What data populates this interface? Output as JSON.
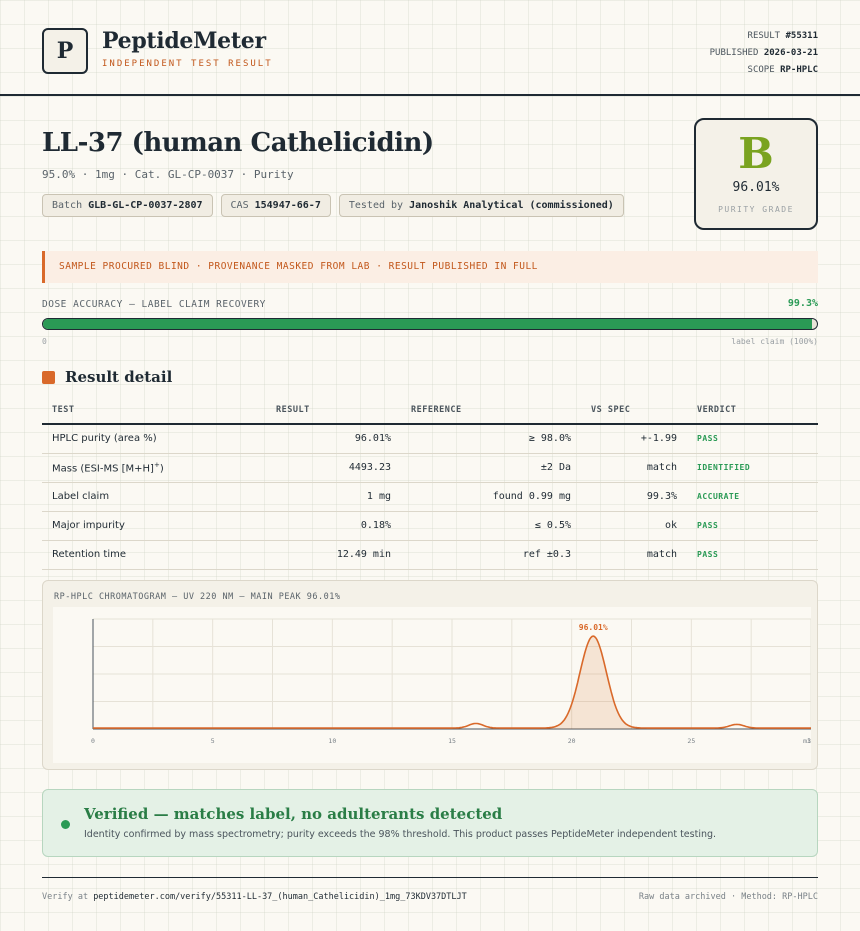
{
  "brand": {
    "logo_letter": "P",
    "name": "PeptideMeter",
    "subtitle": "INDEPENDENT TEST RESULT"
  },
  "meta": {
    "result_label": "RESULT",
    "result_value": "#55311",
    "published_label": "PUBLISHED",
    "published_value": "2026-03-21",
    "scope_label": "SCOPE",
    "scope_value": "RP-HPLC"
  },
  "product": {
    "title": "LL-37 (human Cathelicidin)",
    "subline": "95.0% · 1mg · Cat. GL-CP-0037 · Purity",
    "batch_label": "Batch",
    "batch_value": "GLB-GL-CP-0037-2807",
    "cas_label": "CAS",
    "cas_value": "154947-66-7",
    "tested_label": "Tested by",
    "tested_value": "Janoshik Analytical (commissioned)"
  },
  "grade": {
    "letter": "B",
    "value": "96.01%",
    "label": "PURITY GRADE",
    "color": "#7aa320"
  },
  "notice": "SAMPLE PROCURED BLIND · PROVENANCE MASKED FROM LAB · RESULT PUBLISHED IN FULL",
  "dose": {
    "label": "DOSE ACCURACY — LABEL CLAIM RECOVERY",
    "value_text": "99.3%",
    "fraction": 0.993,
    "min_label": "0",
    "max_label": "label claim (100%)"
  },
  "section_title": "Result detail",
  "table": {
    "headers": [
      "TEST",
      "RESULT",
      "REFERENCE",
      "VS SPEC",
      "VERDICT"
    ],
    "rows": [
      {
        "test": "HPLC purity (area %)",
        "result": "96.01%",
        "reference": "≥ 98.0%",
        "vs_spec": "+-1.99",
        "verdict": "PASS"
      },
      {
        "test": "Mass (ESI-MS [M+H]",
        "test_sup": "+",
        "test_end": ")",
        "result": "4493.23",
        "reference": "±2 Da",
        "vs_spec": "match",
        "verdict": "IDENTIFIED"
      },
      {
        "test": "Label claim",
        "result": "1 mg",
        "reference": "found 0.99 mg",
        "vs_spec": "99.3%",
        "verdict": "ACCURATE"
      },
      {
        "test": "Major impurity",
        "result": "0.18%",
        "reference": "≤ 0.5%",
        "vs_spec": "ok",
        "verdict": "PASS"
      },
      {
        "test": "Retention time",
        "result": "12.49 min",
        "reference": "ref ±0.3",
        "vs_spec": "match",
        "verdict": "PASS"
      }
    ]
  },
  "chart_data": {
    "type": "line",
    "title": "RP-HPLC CHROMATOGRAM — UV 220 NM — MAIN PEAK 96.01%",
    "xlabel": "min",
    "ylabel": "",
    "xlim": [
      0,
      30
    ],
    "x_ticks": [
      "0",
      "5",
      "10",
      "15",
      "20",
      "25",
      "30"
    ],
    "peak_label": "96.01%",
    "peaks": [
      {
        "x": 16.0,
        "height": 0.05,
        "width": 0.3
      },
      {
        "x": 20.9,
        "height": 1.0,
        "width": 0.55
      },
      {
        "x": 26.9,
        "height": 0.04,
        "width": 0.3
      }
    ],
    "baseline": 0.01,
    "color": "#d9692a"
  },
  "verified": {
    "title": "Verified — matches label, no adulterants detected",
    "body": "Identity confirmed by mass spectrometry; purity exceeds the 98% threshold. This product passes PeptideMeter independent testing."
  },
  "footer": {
    "verify_prefix": "Verify at",
    "verify_url": "peptidemeter.com/verify/55311-LL-37_(human_Cathelicidin)_1mg_73KDV37DTLJT",
    "right": "Raw data archived · Method: RP-HPLC"
  },
  "colors": {
    "accent": "#d9692a",
    "pass": "#2a9a55",
    "ink": "#1f2a33"
  }
}
